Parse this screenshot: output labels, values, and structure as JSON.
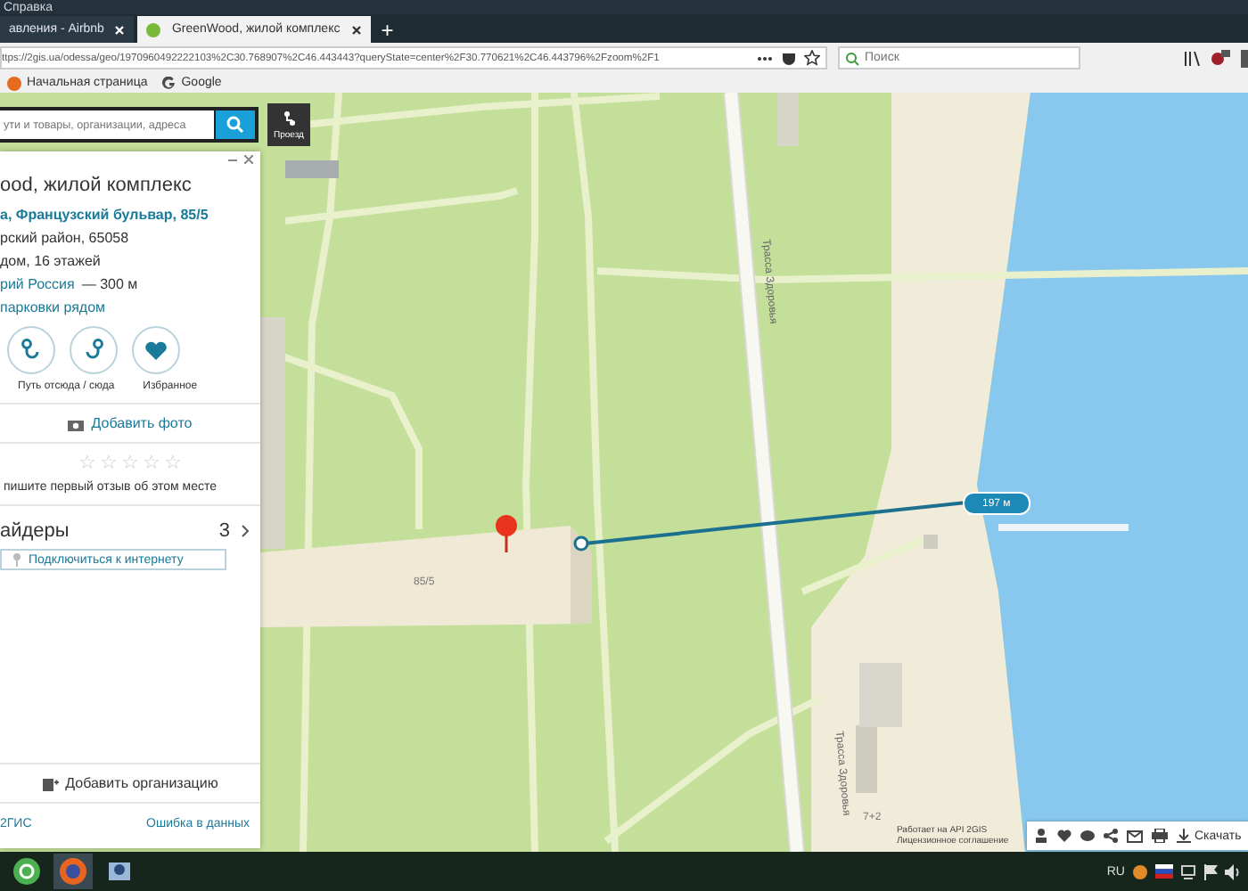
{
  "browser": {
    "menu": [
      "Справка"
    ],
    "tabs": [
      {
        "title": "авления - Airbnb",
        "selected": false
      },
      {
        "title": "GreenWood, жилой комплекс",
        "selected": true
      }
    ],
    "new_tab": "+",
    "url": "ttps://2gis.ua/odessa/geo/1970960492222103%2C30.768907%2C46.443443?queryState=center%2F30.770621%2C46.443796%2Fzoom%2F1",
    "search": {
      "placeholder": "Поиск"
    },
    "bookmarks": [
      "Начальная страница",
      "Google"
    ]
  },
  "map_search": {
    "placeholder": "ути и товары, организации, адреса",
    "route_button": "Проезд"
  },
  "place_card": {
    "title": "ood, жилой комплекс",
    "address": "а, Французский бульвар, 85/5",
    "district": "рский район, 65058",
    "building": "дом, 16 этажей",
    "nearby": {
      "name": "рий Россия",
      "distance": "— 300 м"
    },
    "parking": "парковки рядом",
    "action_labels": [
      "Путь отсюда / сюда",
      "Избранное"
    ],
    "add_photo": "Добавить фото",
    "stars": 0,
    "review_prompt": "пишите первый отзыв об этом месте",
    "providers": {
      "title": "айдеры",
      "count": "3",
      "button": "Подключиться к интернету"
    },
    "add_org": "Добавить организацию",
    "footer": [
      "2ГИС",
      "Ошибка в данных"
    ]
  },
  "map": {
    "building_label": "85/5",
    "road_labels": [
      "Трасса Здоровья",
      "Трасса Здоровья"
    ],
    "distance": "197 м",
    "house_label": "7+2",
    "attribution": [
      "Работает на API 2GIS",
      "Лицензионное соглашение"
    ],
    "download": "Скачать"
  },
  "taskbar": {
    "language": "RU"
  }
}
